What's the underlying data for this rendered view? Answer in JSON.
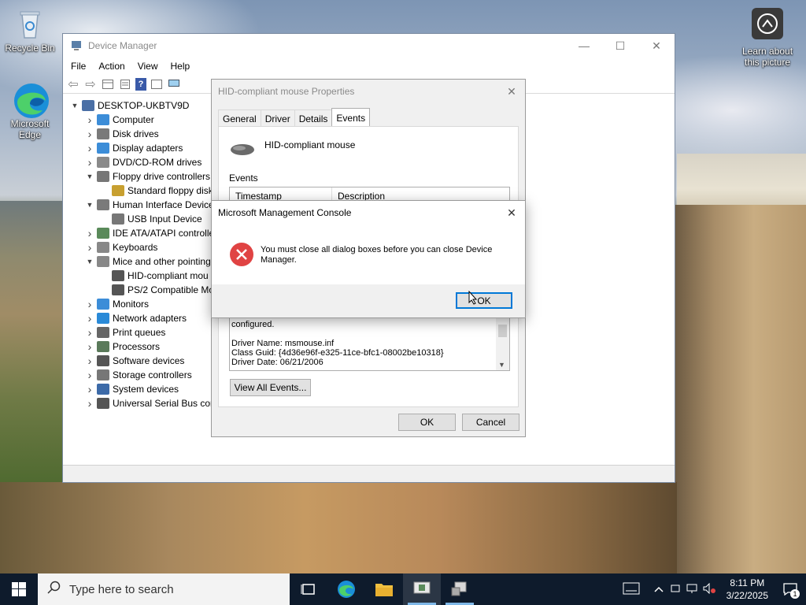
{
  "desktop": {
    "icons": [
      {
        "label": "Recycle Bin"
      },
      {
        "label": "Microsoft Edge"
      },
      {
        "label": "Learn about this picture"
      }
    ]
  },
  "device_manager": {
    "title": "Device Manager",
    "menu": [
      "File",
      "Action",
      "View",
      "Help"
    ],
    "tree": [
      {
        "label": "DESKTOP-UKBTV9D",
        "level": 0,
        "expanded": true
      },
      {
        "label": "Computer",
        "level": 1
      },
      {
        "label": "Disk drives",
        "level": 1
      },
      {
        "label": "Display adapters",
        "level": 1
      },
      {
        "label": "DVD/CD-ROM drives",
        "level": 1
      },
      {
        "label": "Floppy drive controllers",
        "level": 1,
        "expanded": true
      },
      {
        "label": "Standard floppy disk",
        "level": 2
      },
      {
        "label": "Human Interface Device",
        "level": 1,
        "expanded": true
      },
      {
        "label": "USB Input Device",
        "level": 2
      },
      {
        "label": "IDE ATA/ATAPI controlle",
        "level": 1
      },
      {
        "label": "Keyboards",
        "level": 1
      },
      {
        "label": "Mice and other pointing",
        "level": 1,
        "expanded": true
      },
      {
        "label": "HID-compliant mou",
        "level": 2
      },
      {
        "label": "PS/2 Compatible Mo",
        "level": 2
      },
      {
        "label": "Monitors",
        "level": 1
      },
      {
        "label": "Network adapters",
        "level": 1
      },
      {
        "label": "Print queues",
        "level": 1
      },
      {
        "label": "Processors",
        "level": 1
      },
      {
        "label": "Software devices",
        "level": 1
      },
      {
        "label": "Storage controllers",
        "level": 1
      },
      {
        "label": "System devices",
        "level": 1
      },
      {
        "label": "Universal Serial Bus cont",
        "level": 1
      }
    ]
  },
  "properties": {
    "title": "HID-compliant mouse Properties",
    "tabs": [
      "General",
      "Driver",
      "Details",
      "Events"
    ],
    "active_tab": "Events",
    "device_name": "HID-compliant mouse",
    "events_label": "Events",
    "columns": [
      "Timestamp",
      "Description"
    ],
    "info_lines": [
      "configured.",
      "",
      "Driver Name: msmouse.inf",
      "Class Guid: {4d36e96f-e325-11ce-bfc1-08002be10318}",
      "Driver Date: 06/21/2006"
    ],
    "view_all_button": "View All Events...",
    "ok_button": "OK",
    "cancel_button": "Cancel"
  },
  "msgbox": {
    "title": "Microsoft Management Console",
    "message": "You must close all dialog boxes before you can close Device Manager.",
    "ok_button": "OK",
    "close_glyph": "✕"
  },
  "taskbar": {
    "search_placeholder": "Type here to search",
    "time": "8:11 PM",
    "date": "3/22/2025",
    "notification_count": "1"
  }
}
